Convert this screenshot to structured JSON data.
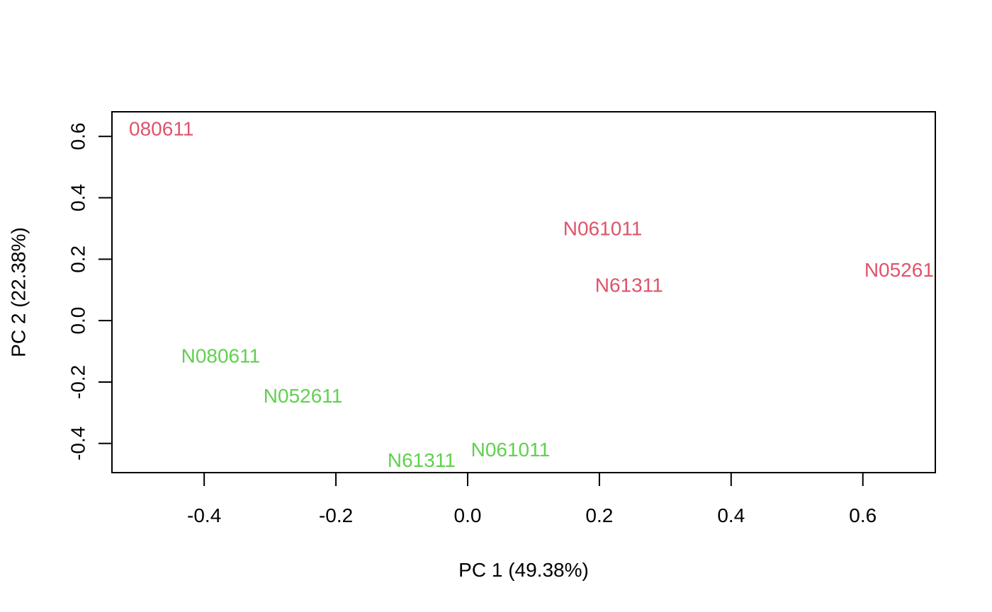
{
  "chart_data": {
    "type": "scatter",
    "xlabel": "PC 1 (49.38%)",
    "ylabel": "PC 2 (22.38%)",
    "xlim": [
      -0.54,
      0.71
    ],
    "ylim": [
      -0.495,
      0.68
    ],
    "xticks": [
      -0.4,
      -0.2,
      0.0,
      0.2,
      0.4,
      0.6
    ],
    "xtick_labels": [
      "-0.4",
      "-0.2",
      "0.0",
      "0.2",
      "0.4",
      "0.6"
    ],
    "yticks": [
      -0.4,
      -0.2,
      0.0,
      0.2,
      0.4,
      0.6
    ],
    "ytick_labels": [
      "-0.4",
      "-0.2",
      "0.0",
      "0.2",
      "0.4",
      "0.6"
    ],
    "grid": false,
    "points": [
      {
        "label": "080611",
        "x": -0.465,
        "y": 0.625,
        "color": "#DF536B"
      },
      {
        "label": "N061011",
        "x": 0.205,
        "y": 0.3,
        "color": "#DF536B"
      },
      {
        "label": "N61311",
        "x": 0.245,
        "y": 0.115,
        "color": "#DF536B"
      },
      {
        "label": "N05261",
        "x": 0.655,
        "y": 0.165,
        "color": "#DF536B"
      },
      {
        "label": "N080611",
        "x": -0.375,
        "y": -0.115,
        "color": "#61D04F"
      },
      {
        "label": "N052611",
        "x": -0.25,
        "y": -0.245,
        "color": "#61D04F"
      },
      {
        "label": "N61311",
        "x": -0.07,
        "y": -0.455,
        "color": "#61D04F"
      },
      {
        "label": "N061011",
        "x": 0.065,
        "y": -0.42,
        "color": "#61D04F"
      }
    ]
  }
}
